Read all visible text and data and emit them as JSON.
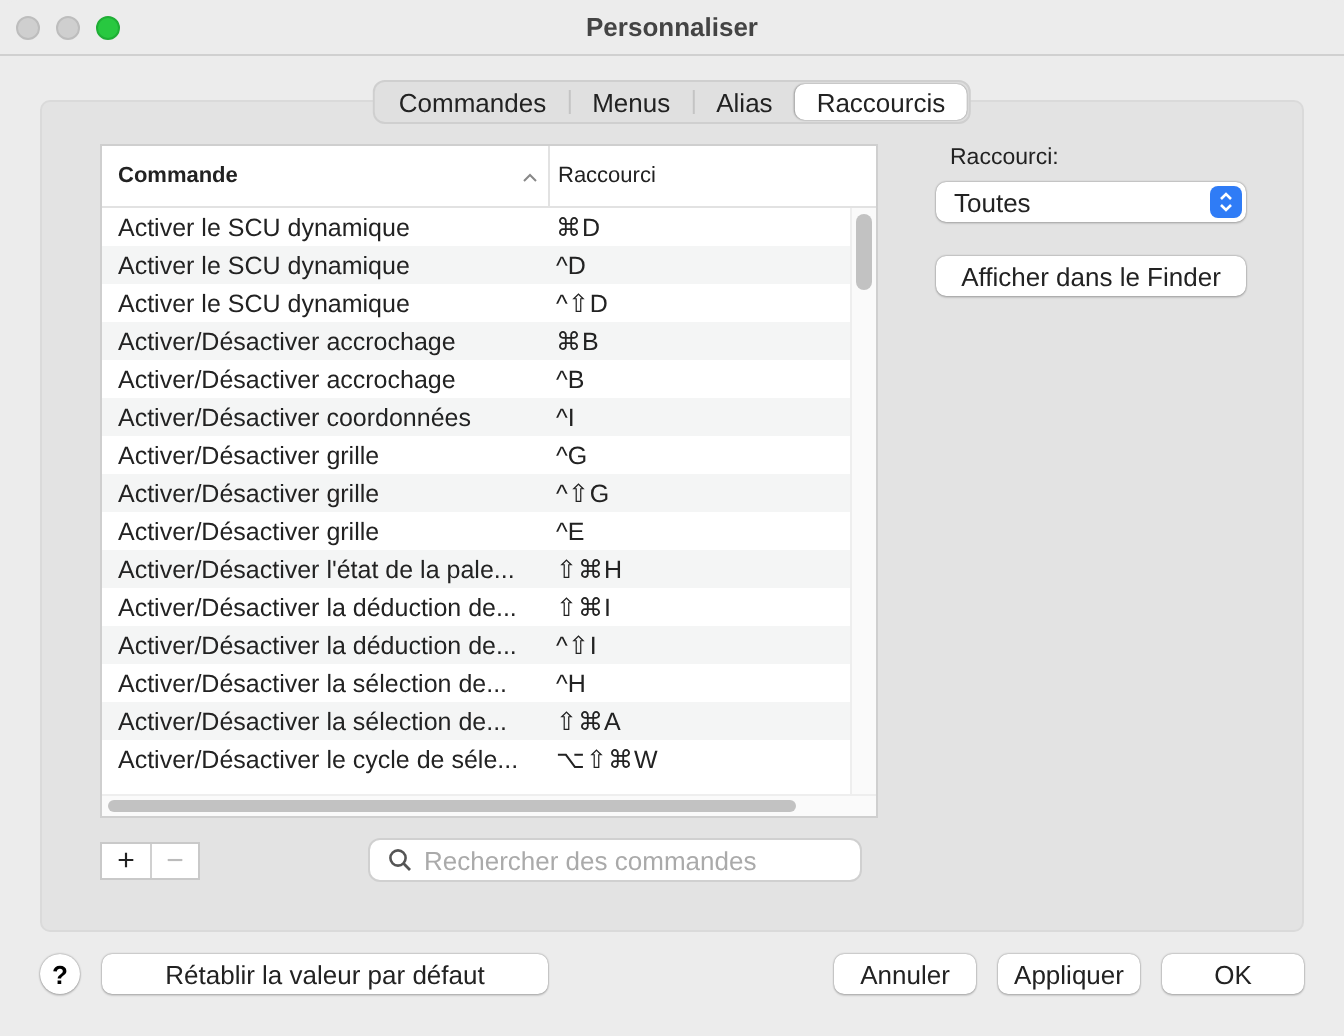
{
  "window": {
    "title": "Personnaliser",
    "controls": [
      {
        "kind": "close",
        "disabled": true
      },
      {
        "kind": "minimize",
        "disabled": true
      },
      {
        "kind": "zoom",
        "disabled": false
      }
    ]
  },
  "tabs": [
    {
      "label": "Commandes",
      "selected": false
    },
    {
      "label": "Menus",
      "selected": false
    },
    {
      "label": "Alias",
      "selected": false
    },
    {
      "label": "Raccourcis",
      "selected": true
    }
  ],
  "table": {
    "columns": [
      "Commande",
      "Raccourci"
    ],
    "rows": [
      {
        "command": "Activer le SCU dynamique",
        "shortcut": "⌘D"
      },
      {
        "command": "Activer le SCU dynamique",
        "shortcut": "^D"
      },
      {
        "command": "Activer le SCU dynamique",
        "shortcut": "^⇧D"
      },
      {
        "command": "Activer/Désactiver accrochage",
        "shortcut": "⌘B"
      },
      {
        "command": "Activer/Désactiver accrochage",
        "shortcut": "^B"
      },
      {
        "command": "Activer/Désactiver coordonnées",
        "shortcut": "^I"
      },
      {
        "command": "Activer/Désactiver grille",
        "shortcut": "^G"
      },
      {
        "command": "Activer/Désactiver grille",
        "shortcut": "^⇧G"
      },
      {
        "command": "Activer/Désactiver grille",
        "shortcut": "^E"
      },
      {
        "command": "Activer/Désactiver l'état de la pale...",
        "shortcut": "⇧⌘H"
      },
      {
        "command": "Activer/Désactiver la déduction de...",
        "shortcut": "⇧⌘I"
      },
      {
        "command": "Activer/Désactiver la déduction de...",
        "shortcut": "^⇧I"
      },
      {
        "command": "Activer/Désactiver la sélection de...",
        "shortcut": "^H"
      },
      {
        "command": "Activer/Désactiver la sélection de...",
        "shortcut": "⇧⌘A"
      },
      {
        "command": "Activer/Désactiver le cycle de séle...",
        "shortcut": "⌥⇧⌘W"
      }
    ]
  },
  "list_buttons": [
    {
      "label": "+",
      "disabled": false
    },
    {
      "label": "−",
      "disabled": true
    }
  ],
  "search": {
    "placeholder": "Rechercher des commandes"
  },
  "filter": {
    "label": "Raccourci:",
    "value": "Toutes"
  },
  "finder_button": "Afficher dans le Finder",
  "help_button": "?",
  "reset_button": "Rétablir la valeur par défaut",
  "buttons": [
    "Annuler",
    "Appliquer",
    "OK"
  ]
}
